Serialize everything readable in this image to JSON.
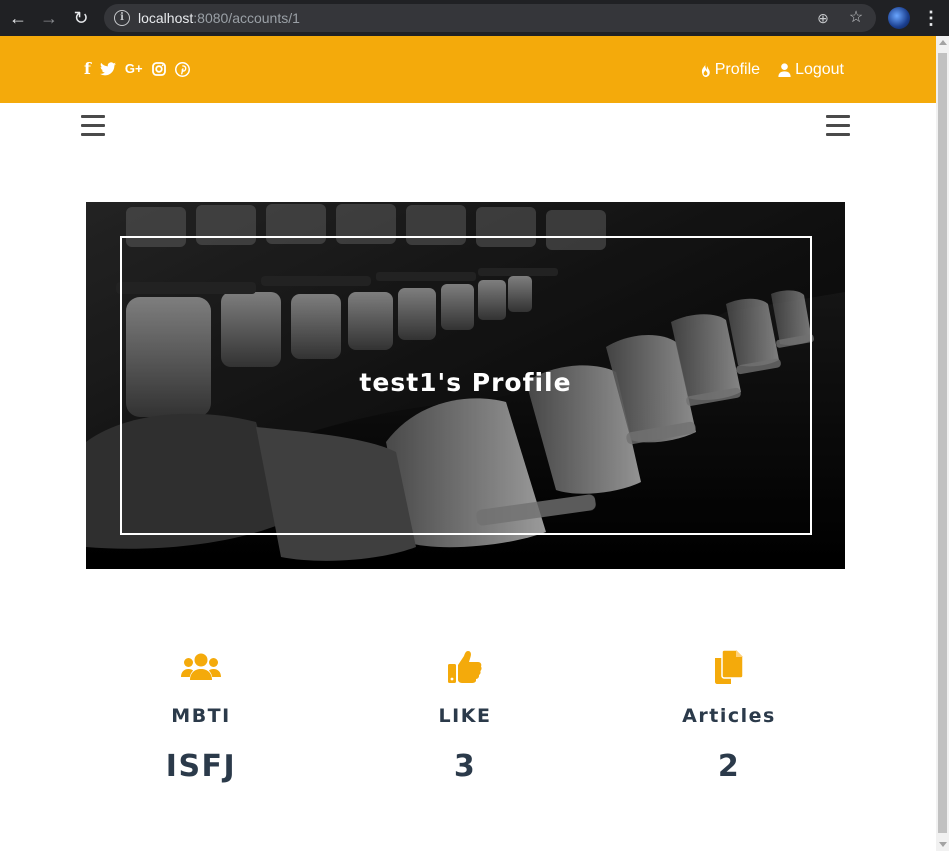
{
  "browser": {
    "url_host": "localhost",
    "url_rest": ":8080/accounts/1",
    "back_glyph": "←",
    "forward_glyph": "→",
    "reload_glyph": "↻",
    "info_glyph": "i",
    "zoom_glyph": "⊕",
    "star_glyph": "☆",
    "menu_glyph": "⋮"
  },
  "topbar": {
    "background": "#f4aa0b",
    "social": [
      {
        "name": "facebook-icon",
        "glyph": "f"
      },
      {
        "name": "twitter-icon",
        "glyph": "🐦"
      },
      {
        "name": "google-plus-icon",
        "glyph": "G+"
      },
      {
        "name": "instagram-icon",
        "glyph": "◎"
      },
      {
        "name": "pinterest-icon",
        "glyph": "ⓟ"
      }
    ],
    "profile_label": "Profile",
    "logout_label": "Logout"
  },
  "hero": {
    "title": "test1's Profile"
  },
  "stats": {
    "accent": "#f4aa0b",
    "mbti_label": "MBTI",
    "mbti_value": "ISFJ",
    "like_label": "LIKE",
    "like_value": "3",
    "articles_label": "Articles",
    "articles_value": "2"
  }
}
